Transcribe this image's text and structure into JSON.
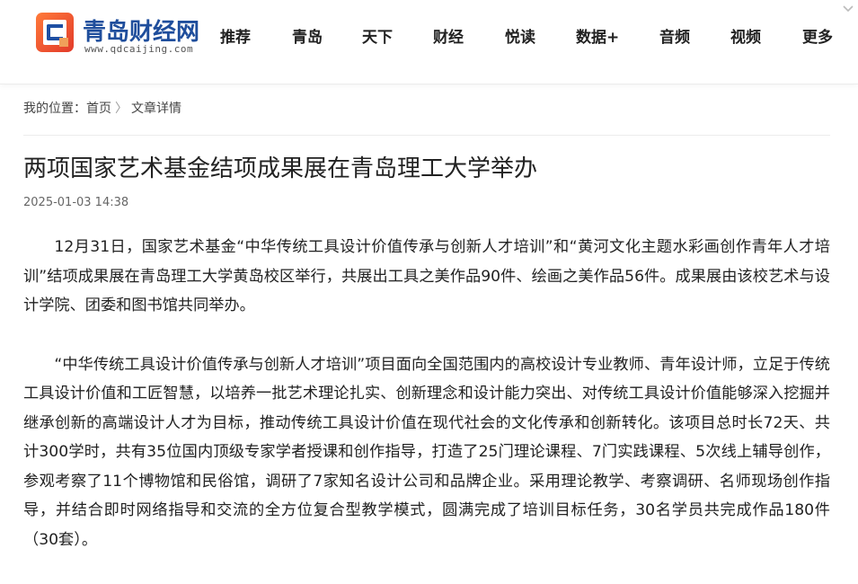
{
  "brand": {
    "name": "青岛财经网",
    "domain": "www.qdcaijing.com",
    "colors": {
      "accent_orange": "#e8522a",
      "brand_blue": "#1f4e9c"
    }
  },
  "nav": {
    "items": [
      "推荐",
      "青岛",
      "天下",
      "财经",
      "悦读",
      "数据+",
      "音频",
      "视频",
      "更多"
    ],
    "more_icon": "chevron-down-icon"
  },
  "breadcrumb": {
    "prefix": "我的位置：",
    "home": "首页",
    "current": "文章详情"
  },
  "article": {
    "title": "两项国家艺术基金结项成果展在青岛理工大学举办",
    "date": "2025-01-03 14:38",
    "paragraphs": [
      "12月31日，国家艺术基金“中华传统工具设计价值传承与创新人才培训”和“黄河文化主题水彩画创作青年人才培训”结项成果展在青岛理工大学黄岛校区举行，共展出工具之美作品90件、绘画之美作品56件。成果展由该校艺术与设计学院、团委和图书馆共同举办。",
      "“中华传统工具设计价值传承与创新人才培训”项目面向全国范围内的高校设计专业教师、青年设计师，立足于传统工具设计价值和工匠智慧，以培养一批艺术理论扎实、创新理念和设计能力突出、对传统工具设计价值能够深入挖掘并继承创新的高端设计人才为目标，推动传统工具设计价值在现代社会的文化传承和创新转化。该项目总时长72天、共计300学时，共有35位国内顶级专家学者授课和创作指导，打造了25门理论课程、7门实践课程、5次线上辅导创作，参观考察了11个博物馆和民俗馆，调研了7家知名设计公司和品牌企业。采用理论教学、考察调研、名师现场创作指导，并结合即时网络指导和交流的全方位复合型教学模式，圆满完成了培训目标任务，30名学员共完成作品180件（30套）。"
    ]
  }
}
